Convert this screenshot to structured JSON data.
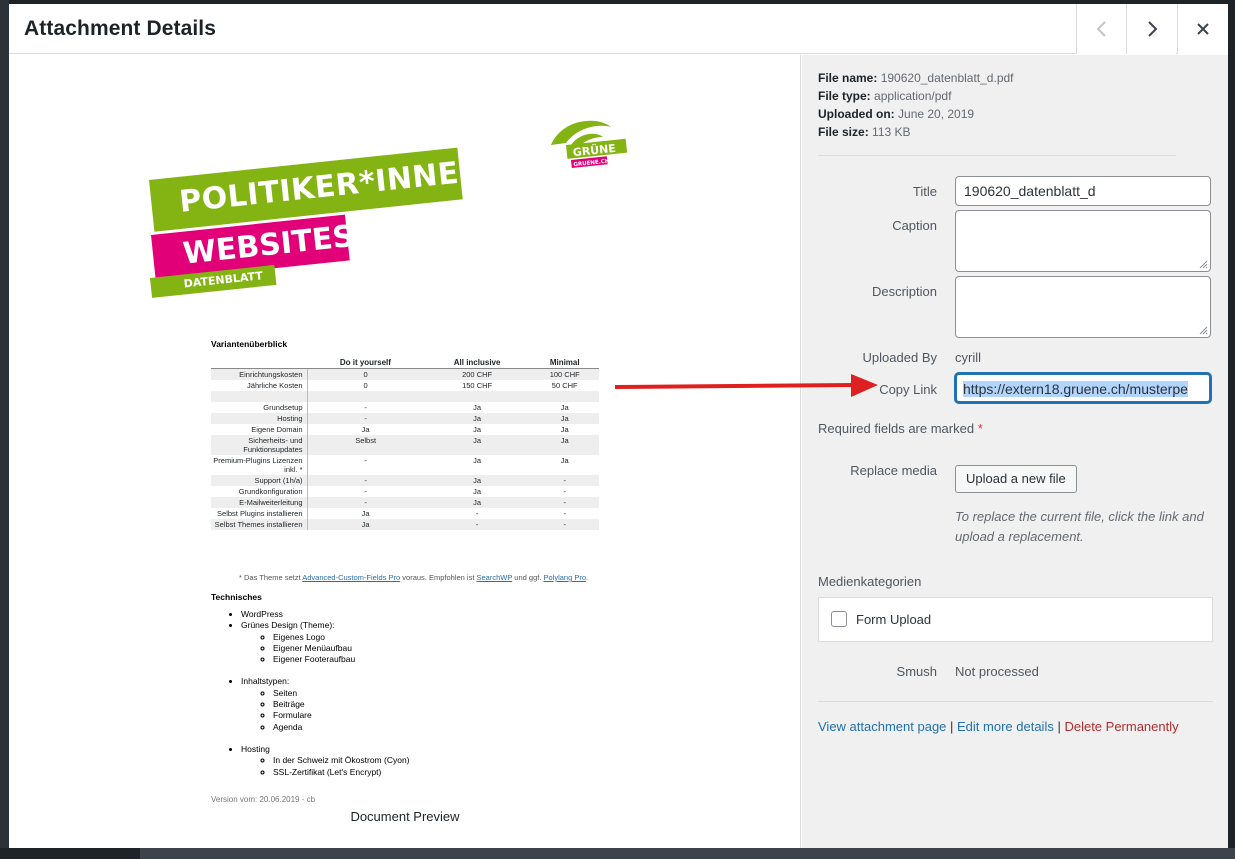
{
  "modal": {
    "title": "Attachment Details",
    "prev_label": "Previous",
    "next_label": "Next",
    "close_label": "Close"
  },
  "preview": {
    "label": "Document Preview",
    "doc": {
      "banner_line1": "POLITIKER*INNEN",
      "banner_line2": "WEBSITES",
      "banner_line3": "DATENBLATT",
      "logo_text": "GRÜNE",
      "logo_sub": "GRUENE.CH",
      "overview_title": "Variantenüberblick",
      "columns": [
        "",
        "Do it yourself",
        "All inclusive",
        "Minimal"
      ],
      "rows": [
        [
          "Einrichtungskosten",
          "0",
          "200 CHF",
          "100 CHF"
        ],
        [
          "Jährliche Kosten",
          "0",
          "150 CHF",
          "50 CHF"
        ],
        [
          "",
          "",
          "",
          ""
        ],
        [
          "Grundsetup",
          "-",
          "Ja",
          "Ja"
        ],
        [
          "Hosting",
          "-",
          "Ja",
          "Ja"
        ],
        [
          "Eigene Domain",
          "Ja",
          "Ja",
          "Ja"
        ],
        [
          "Sicherheits- und Funktionsupdates",
          "Selbst",
          "Ja",
          "Ja"
        ],
        [
          "Premium-Plugins Lizenzen inkl. *",
          "-",
          "Ja",
          "Ja"
        ],
        [
          "Support (1h/a)",
          "-",
          "Ja",
          "-"
        ],
        [
          "Grundkonfiguration",
          "-",
          "Ja",
          "-"
        ],
        [
          "E-Mailweiterleitung",
          "-",
          "Ja",
          "-"
        ],
        [
          "Selbst Plugins installieren",
          "Ja",
          "-",
          "-"
        ],
        [
          "Selbst Themes installieren",
          "Ja",
          "-",
          "-"
        ]
      ],
      "footnote_pre": "* Das Theme setzt ",
      "footnote_link1": "Advanced-Custom-Fields Pro",
      "footnote_mid": " voraus. Empfohlen ist ",
      "footnote_link2": "SearchWP",
      "footnote_mid2": " und ggf. ",
      "footnote_link3": "Polylang Pro",
      "footnote_end": ".",
      "tech_title": "Technisches",
      "tech": {
        "wp": "WordPress",
        "design": "Grünes Design (Theme):",
        "design_items": [
          "Eigenes Logo",
          "Eigener Menüaufbau",
          "Eigener Footeraufbau"
        ],
        "content": "Inhaltstypen:",
        "content_items": [
          "Seiten",
          "Beiträge",
          "Formulare",
          "Agenda"
        ],
        "hosting": "Hosting",
        "hosting_items": [
          "In der Schweiz mit Ökostrom (Cyon)",
          "SSL-Zertifikat (Let's Encrypt)"
        ]
      },
      "version": "Version vom: 20.06.2019 - cb"
    }
  },
  "file_info": {
    "name_label": "File name:",
    "name": "190620_datenblatt_d.pdf",
    "type_label": "File type:",
    "type": "application/pdf",
    "uploaded_label": "Uploaded on:",
    "uploaded": "June 20, 2019",
    "size_label": "File size:",
    "size": "113 KB"
  },
  "form": {
    "title_label": "Title",
    "title_value": "190620_datenblatt_d",
    "caption_label": "Caption",
    "caption_value": "",
    "description_label": "Description",
    "description_value": "",
    "uploaded_by_label": "Uploaded By",
    "uploaded_by": "cyrill",
    "copy_link_label": "Copy Link",
    "copy_link_value": "https://extern18.gruene.ch/musterpe",
    "required_text": "Required fields are marked",
    "required_star": "*",
    "replace_label": "Replace media",
    "upload_button": "Upload a new file",
    "replace_hint": "To replace the current file, click the link and upload a replacement.",
    "categories_title": "Medienkategorien",
    "category_item": "Form Upload",
    "smush_label": "Smush",
    "smush_value": "Not processed"
  },
  "actions": {
    "view": "View attachment page",
    "edit": "Edit more details",
    "delete": "Delete Permanently",
    "sep": " | "
  },
  "colors": {
    "accent": "#2271b1",
    "danger": "#b32d2e",
    "green": "#84b414",
    "pink": "#e10078",
    "arrow": "#e02020"
  }
}
